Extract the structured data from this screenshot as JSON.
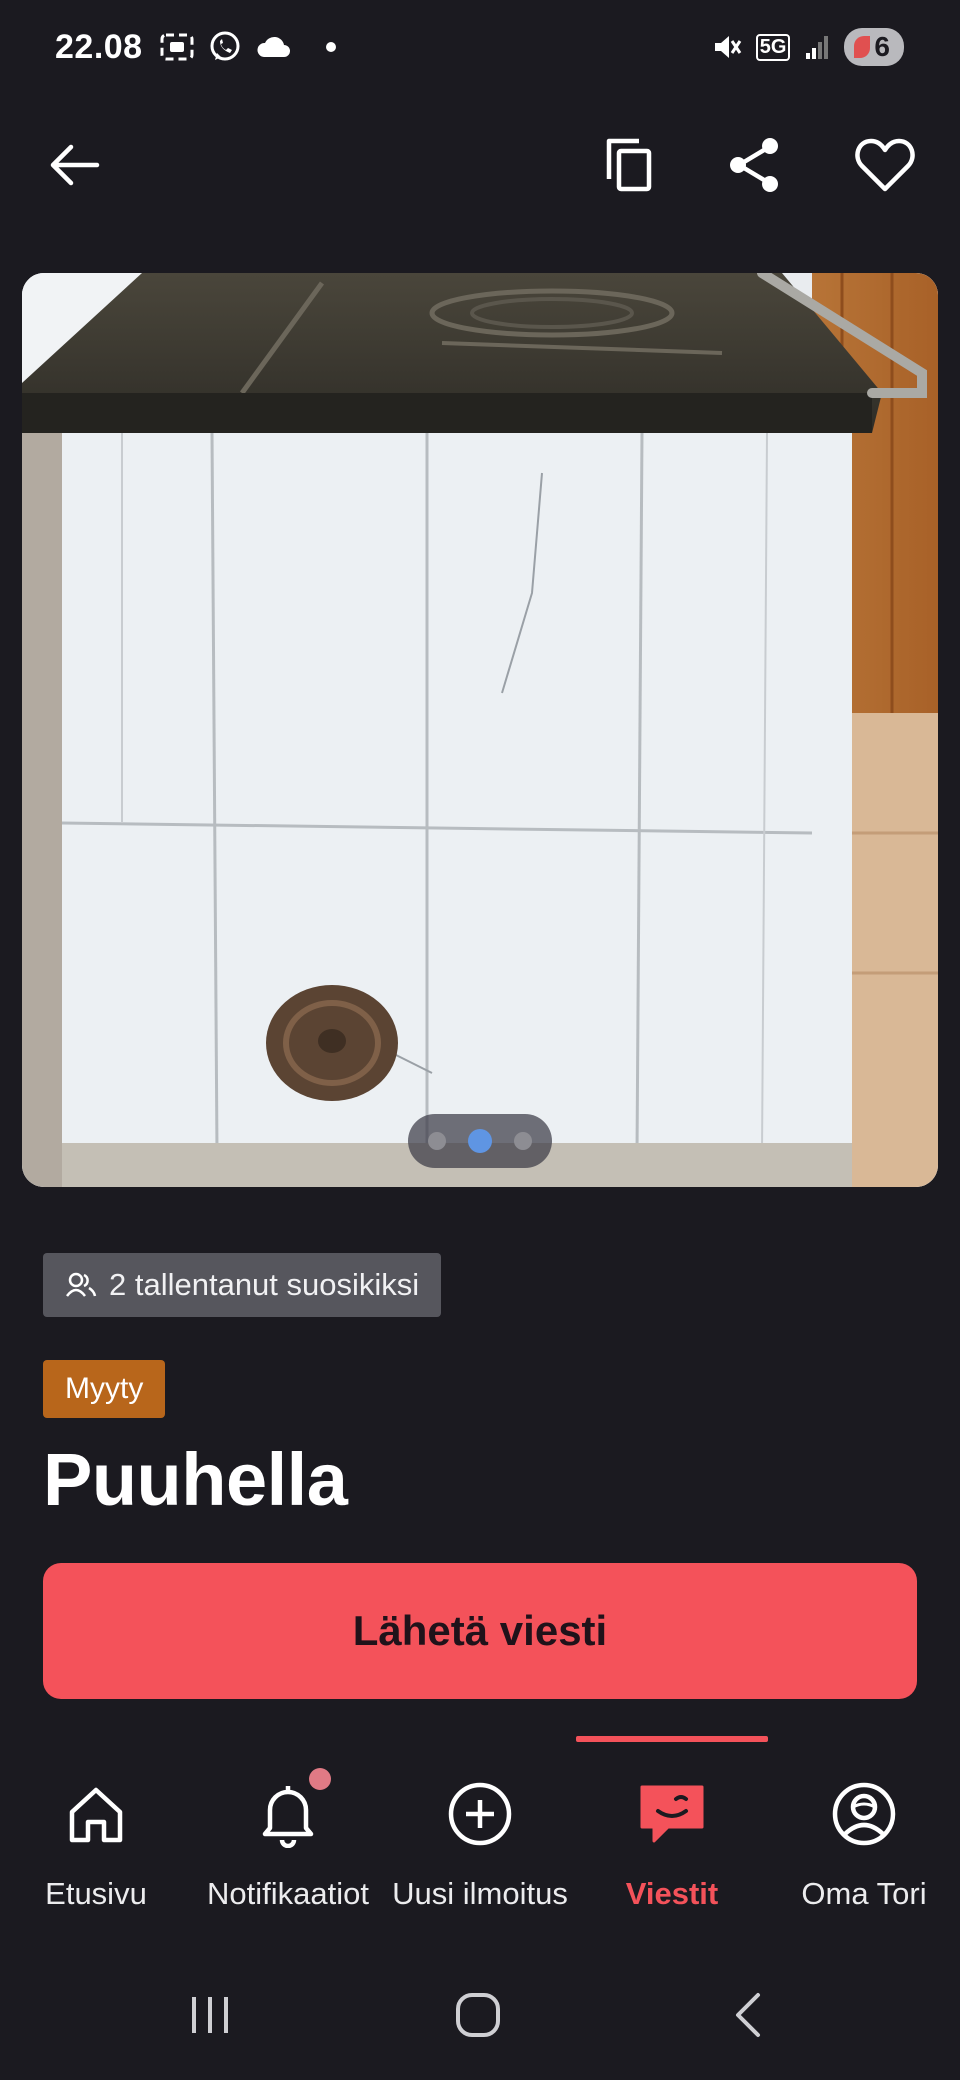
{
  "status_bar": {
    "time": "22.08",
    "network": "5G",
    "battery": "6"
  },
  "top_bar": {
    "back_icon": "arrow-left-icon",
    "copy_icon": "copy-icon",
    "share_icon": "share-icon",
    "favorite_icon": "heart-icon"
  },
  "gallery": {
    "image_description": "photo",
    "page_index": 2,
    "page_count": 3
  },
  "listing": {
    "favorites_label": "2 tallentanut suosikiksi",
    "status": "Myyty",
    "title": "Puuhella",
    "send_message_label": "Lähetä viesti"
  },
  "colors": {
    "background": "#1b1a20",
    "accent": "#f4525a",
    "sold_badge": "#b8661b",
    "chip": "#56565d"
  },
  "bottom_nav": {
    "items": [
      {
        "label": "Etusivu",
        "icon": "home-icon"
      },
      {
        "label": "Notifikaatiot",
        "icon": "bell-icon"
      },
      {
        "label": "Uusi ilmoitus",
        "icon": "plus-circle-icon"
      },
      {
        "label": "Viestit",
        "icon": "chat-icon"
      },
      {
        "label": "Oma Tori",
        "icon": "profile-icon"
      }
    ],
    "active_index": 3
  }
}
